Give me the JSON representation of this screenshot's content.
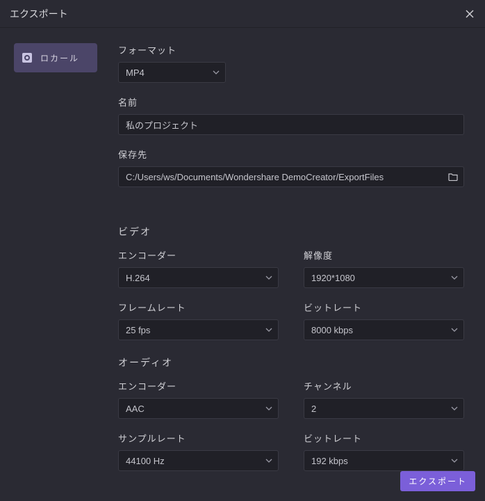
{
  "title": "エクスポート",
  "sidebar": {
    "local_label": "ロカール"
  },
  "format": {
    "label": "フォーマット",
    "value": "MP4"
  },
  "name": {
    "label": "名前",
    "value": "私のプロジェクト"
  },
  "save_to": {
    "label": "保存先",
    "value": "C:/Users/ws/Documents/Wondershare DemoCreator/ExportFiles"
  },
  "video": {
    "heading": "ビデオ",
    "encoder_label": "エンコーダー",
    "encoder_value": "H.264",
    "resolution_label": "解像度",
    "resolution_value": "1920*1080",
    "framerate_label": "フレームレート",
    "framerate_value": "25 fps",
    "bitrate_label": "ビットレート",
    "bitrate_value": "8000 kbps"
  },
  "audio": {
    "heading": "オーディオ",
    "encoder_label": "エンコーダー",
    "encoder_value": "AAC",
    "channel_label": "チャンネル",
    "channel_value": "2",
    "samplerate_label": "サンプルレート",
    "samplerate_value": "44100 Hz",
    "bitrate_label": "ビットレート",
    "bitrate_value": "192 kbps"
  },
  "export_button": "エクスポート"
}
